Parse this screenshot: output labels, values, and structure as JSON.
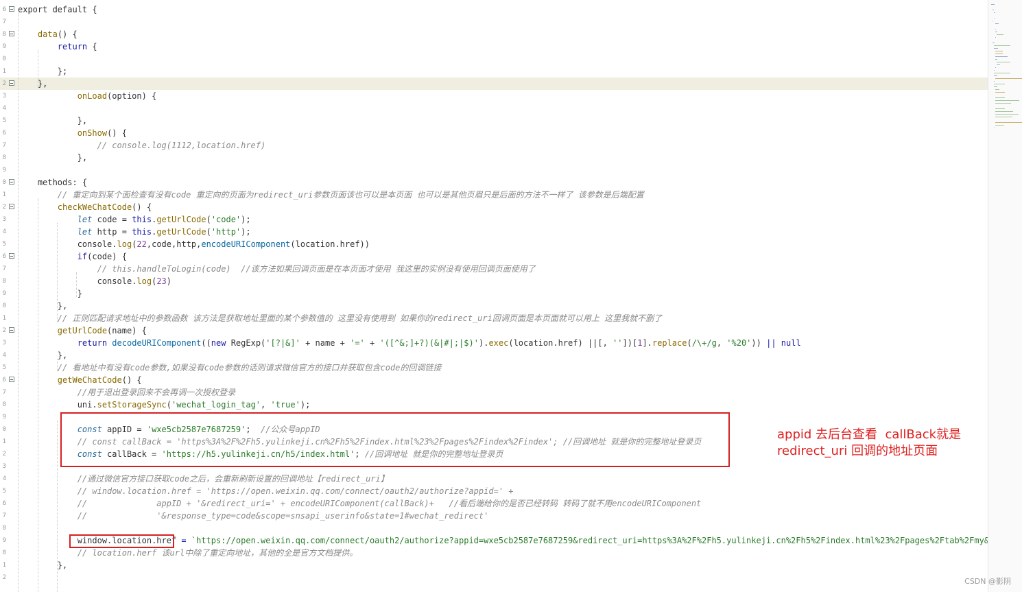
{
  "editor": {
    "lines": [
      {
        "num": "6",
        "fold": true,
        "segs": [
          {
            "t": "export default {"
          }
        ]
      },
      {
        "num": "7",
        "segs": []
      },
      {
        "num": "8",
        "fold": true,
        "segs": [
          {
            "t": "    "
          },
          {
            "t": "data",
            "c": "f"
          },
          {
            "t": "() {"
          }
        ]
      },
      {
        "num": "9",
        "segs": [
          {
            "t": "        "
          },
          {
            "t": "return",
            "c": "k"
          },
          {
            "t": " {"
          }
        ]
      },
      {
        "num": "0",
        "segs": []
      },
      {
        "num": "1",
        "segs": [
          {
            "t": "        };"
          }
        ]
      },
      {
        "num": "2",
        "fold": true,
        "current": true,
        "segs": [
          {
            "t": "    },"
          }
        ]
      },
      {
        "num": "3",
        "segs": [
          {
            "t": "            "
          },
          {
            "t": "onLoad",
            "c": "f"
          },
          {
            "t": "(option) {"
          }
        ]
      },
      {
        "num": "4",
        "segs": []
      },
      {
        "num": "5",
        "segs": [
          {
            "t": "            },"
          }
        ]
      },
      {
        "num": "6",
        "segs": [
          {
            "t": "            "
          },
          {
            "t": "onShow",
            "c": "f"
          },
          {
            "t": "() {"
          }
        ]
      },
      {
        "num": "7",
        "segs": [
          {
            "t": "                "
          },
          {
            "t": "// console.log(1112,location.href)",
            "c": "c"
          }
        ]
      },
      {
        "num": "8",
        "segs": [
          {
            "t": "            },"
          }
        ]
      },
      {
        "num": "9",
        "segs": []
      },
      {
        "num": "0",
        "fold": true,
        "segs": [
          {
            "t": "    methods: {"
          }
        ]
      },
      {
        "num": "1",
        "segs": [
          {
            "t": "        "
          },
          {
            "t": "// 重定向到某个面检查有没有code 重定向的页面为redirect_uri参数页面该也可以是本页面 也可以是其他页眉只是后面的方法不一样了 该参数是后端配置",
            "c": "c"
          }
        ]
      },
      {
        "num": "2",
        "fold": true,
        "segs": [
          {
            "t": "        "
          },
          {
            "t": "checkWeChatCode",
            "c": "f"
          },
          {
            "t": "() {"
          }
        ]
      },
      {
        "num": "3",
        "segs": [
          {
            "t": "            "
          },
          {
            "t": "let",
            "c": "v"
          },
          {
            "t": " code = "
          },
          {
            "t": "this",
            "c": "k"
          },
          {
            "t": "."
          },
          {
            "t": "getUrlCode",
            "c": "f"
          },
          {
            "t": "("
          },
          {
            "t": "'code'",
            "c": "s"
          },
          {
            "t": ");"
          }
        ]
      },
      {
        "num": "4",
        "segs": [
          {
            "t": "            "
          },
          {
            "t": "let",
            "c": "v"
          },
          {
            "t": " http = "
          },
          {
            "t": "this",
            "c": "k"
          },
          {
            "t": "."
          },
          {
            "t": "getUrlCode",
            "c": "f"
          },
          {
            "t": "("
          },
          {
            "t": "'http'",
            "c": "s"
          },
          {
            "t": ");"
          }
        ]
      },
      {
        "num": "5",
        "segs": [
          {
            "t": "            console."
          },
          {
            "t": "log",
            "c": "f"
          },
          {
            "t": "("
          },
          {
            "t": "22",
            "c": "n"
          },
          {
            "t": ",code,http,"
          },
          {
            "t": "encodeURIComponent",
            "c": "m"
          },
          {
            "t": "(location.href))"
          }
        ]
      },
      {
        "num": "6",
        "fold": true,
        "segs": [
          {
            "t": "            "
          },
          {
            "t": "if",
            "c": "k"
          },
          {
            "t": "(code) {"
          }
        ]
      },
      {
        "num": "7",
        "segs": [
          {
            "t": "                "
          },
          {
            "t": "// this.handleToLogin(code)  //该方法如果回调页面是在本页面才使用 我这里的实例没有使用回调页面使用了",
            "c": "c"
          }
        ]
      },
      {
        "num": "8",
        "segs": [
          {
            "t": "                console."
          },
          {
            "t": "log",
            "c": "f"
          },
          {
            "t": "("
          },
          {
            "t": "23",
            "c": "n"
          },
          {
            "t": ")"
          }
        ]
      },
      {
        "num": "9",
        "segs": [
          {
            "t": "            }"
          }
        ]
      },
      {
        "num": "0",
        "segs": [
          {
            "t": "        },"
          }
        ]
      },
      {
        "num": "1",
        "segs": [
          {
            "t": "        "
          },
          {
            "t": "// 正则匹配请求地址中的参数函数 该方法是获取地址里面的某个参数值的 这里没有使用到 如果你的redirect_uri回调页面是本页面就可以用上 这里我就不删了",
            "c": "c"
          }
        ]
      },
      {
        "num": "2",
        "fold": true,
        "segs": [
          {
            "t": "        "
          },
          {
            "t": "getUrlCode",
            "c": "f"
          },
          {
            "t": "(name) {"
          }
        ]
      },
      {
        "num": "3",
        "segs": [
          {
            "t": "            "
          },
          {
            "t": "return",
            "c": "k"
          },
          {
            "t": " "
          },
          {
            "t": "decodeURIComponent",
            "c": "m"
          },
          {
            "t": "(("
          },
          {
            "t": "new",
            "c": "k"
          },
          {
            "t": " RegExp("
          },
          {
            "t": "'[?|&]'",
            "c": "s"
          },
          {
            "t": " + name + "
          },
          {
            "t": "'='",
            "c": "s"
          },
          {
            "t": " + "
          },
          {
            "t": "'([^&;]+?)(&|#|;|$)'",
            "c": "s"
          },
          {
            "t": ")."
          },
          {
            "t": "exec",
            "c": "f"
          },
          {
            "t": "(location.href) ||[, "
          },
          {
            "t": "''",
            "c": "s"
          },
          {
            "t": "])["
          },
          {
            "t": "1",
            "c": "n"
          },
          {
            "t": "]."
          },
          {
            "t": "replace",
            "c": "f"
          },
          {
            "t": "("
          },
          {
            "t": "/\\+/g",
            "c": "s"
          },
          {
            "t": ", "
          },
          {
            "t": "'%20'",
            "c": "s"
          },
          {
            "t": ")) "
          },
          {
            "t": "||",
            "c": "k"
          },
          {
            "t": " "
          },
          {
            "t": "null",
            "c": "k"
          }
        ]
      },
      {
        "num": "4",
        "segs": [
          {
            "t": "        },"
          }
        ]
      },
      {
        "num": "5",
        "segs": [
          {
            "t": "        "
          },
          {
            "t": "// 看地址中有没有code参数,如果没有code参数的话则请求微信官方的接口并获取包含code的回调链接",
            "c": "c"
          }
        ]
      },
      {
        "num": "6",
        "fold": true,
        "segs": [
          {
            "t": "        "
          },
          {
            "t": "getWeChatCode",
            "c": "f"
          },
          {
            "t": "() {"
          }
        ]
      },
      {
        "num": "7",
        "segs": [
          {
            "t": "            "
          },
          {
            "t": "//用于退出登录回来不会再调一次授权登录",
            "c": "c"
          }
        ]
      },
      {
        "num": "8",
        "segs": [
          {
            "t": "            uni."
          },
          {
            "t": "setStorageSync",
            "c": "f"
          },
          {
            "t": "("
          },
          {
            "t": "'wechat_login_tag'",
            "c": "s"
          },
          {
            "t": ", "
          },
          {
            "t": "'true'",
            "c": "s"
          },
          {
            "t": ");"
          }
        ]
      },
      {
        "num": "9",
        "segs": []
      },
      {
        "num": "0",
        "segs": [
          {
            "t": "            "
          },
          {
            "t": "const",
            "c": "v"
          },
          {
            "t": " appID = "
          },
          {
            "t": "'wxe5cb2587e7687259'",
            "c": "s"
          },
          {
            "t": ";  "
          },
          {
            "t": "//公众号appID",
            "c": "c"
          }
        ]
      },
      {
        "num": "1",
        "segs": [
          {
            "t": "            "
          },
          {
            "t": "// const callBack = 'https%3A%2F%2Fh5.yulinkeji.cn%2Fh5%2Findex.html%23%2Fpages%2Findex%2Findex'; //回调地址 就是你的完整地址登录页",
            "c": "c"
          }
        ]
      },
      {
        "num": "2",
        "segs": [
          {
            "t": "            "
          },
          {
            "t": "const",
            "c": "v"
          },
          {
            "t": " callBack = "
          },
          {
            "t": "'https://h5.yulinkeji.cn/h5/index.html'",
            "c": "s"
          },
          {
            "t": "; "
          },
          {
            "t": "//回调地址 就是你的完整地址登录页",
            "c": "c"
          }
        ]
      },
      {
        "num": "3",
        "segs": []
      },
      {
        "num": "4",
        "segs": [
          {
            "t": "            "
          },
          {
            "t": "//通过微信官方接口获取code之后，会重新刷新设置的回调地址【redirect_uri】",
            "c": "c"
          }
        ]
      },
      {
        "num": "5",
        "segs": [
          {
            "t": "            "
          },
          {
            "t": "// window.location.href = 'https://open.weixin.qq.com/connect/oauth2/authorize?appid=' +",
            "c": "c"
          }
        ]
      },
      {
        "num": "6",
        "segs": [
          {
            "t": "            "
          },
          {
            "t": "//              appID + '&redirect_uri=' + encodeURIComponent(callBack)+   //看后端给你的是否已经转码 转码了就不用encodeURIComponent",
            "c": "c"
          }
        ]
      },
      {
        "num": "7",
        "segs": [
          {
            "t": "            "
          },
          {
            "t": "//              '&response_type=code&scope=snsapi_userinfo&state=1#wechat_redirect'",
            "c": "c"
          }
        ]
      },
      {
        "num": "8",
        "segs": []
      },
      {
        "num": "9",
        "segs": [
          {
            "t": "            window.location.href"
          },
          {
            "t": " = ",
            "c": "k"
          },
          {
            "t": "`https://open.weixin.qq.com/connect/oauth2/authorize?appid=wxe5cb2587e7687259&redirect_uri=https%3A%2F%2Fh5.yulinkeji.cn%2Fh5%2Findex.html%23%2Fpages%2Ftab%2Fmy&respon",
            "c": "s"
          }
        ]
      },
      {
        "num": "0",
        "segs": [
          {
            "t": "            "
          },
          {
            "t": "// location.herf 该url中除了重定向地址，其他的全是官方文档提供。",
            "c": "c"
          }
        ]
      },
      {
        "num": "1",
        "segs": [
          {
            "t": "        },"
          }
        ]
      },
      {
        "num": "2",
        "segs": []
      }
    ]
  },
  "annotation": {
    "note": "appid 去后台查看  callBack就是\nredirect_uri 回调的地址页面",
    "box_color": "#d62020"
  },
  "watermark": "CSDN @影阴"
}
